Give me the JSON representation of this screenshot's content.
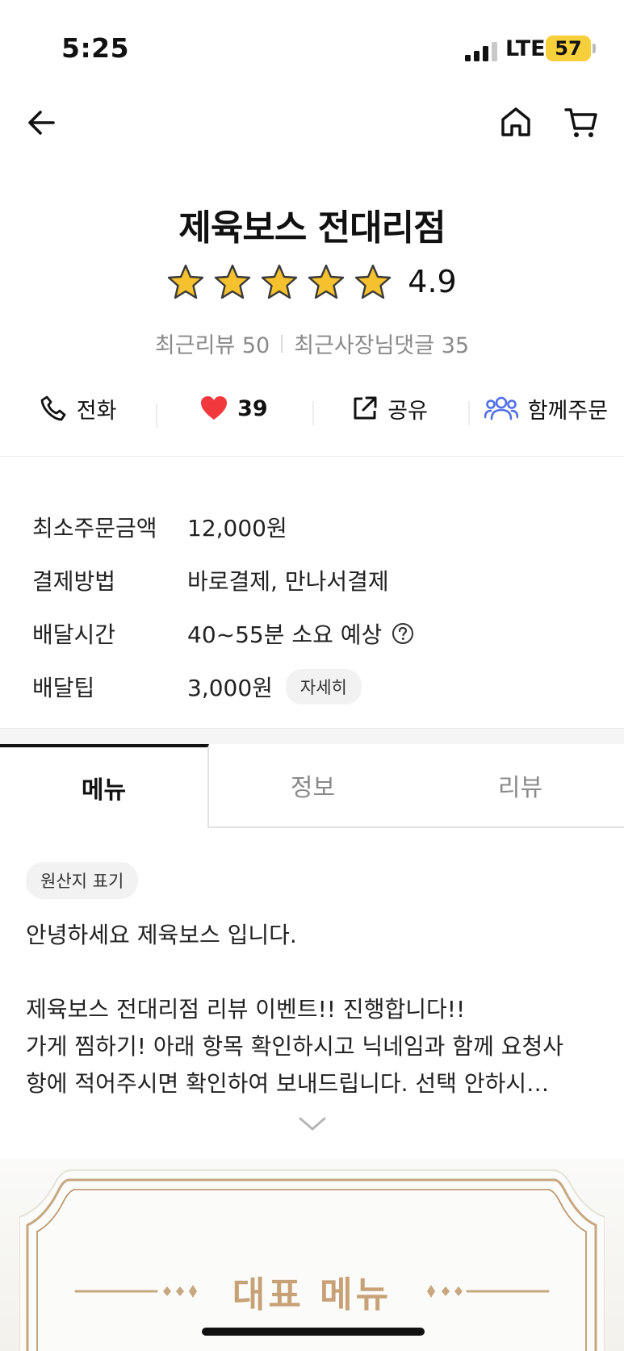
{
  "status_bar": {
    "time": "5:25",
    "network": "LTE",
    "battery": "57"
  },
  "nav": {
    "back_icon": "arrow-left-icon",
    "home_icon": "home-icon",
    "cart_icon": "cart-icon"
  },
  "store": {
    "name": "제육보스 전대리점",
    "rating": "4.9",
    "stars": 5,
    "recent_reviews": "최근리뷰 50",
    "owner_replies": "최근사장님댓글 35"
  },
  "actions": {
    "call": "전화",
    "likes": "39",
    "share": "공유",
    "group_order": "함께주문"
  },
  "info": {
    "min_order_label": "최소주문금액",
    "min_order_value": "12,000원",
    "payment_label": "결제방법",
    "payment_value": "바로결제, 만나서결제",
    "delivery_time_label": "배달시간",
    "delivery_time_value": "40~55분 소요 예상",
    "delivery_tip_label": "배달팁",
    "delivery_tip_value": "3,000원",
    "detail_button": "자세히"
  },
  "tabs": [
    {
      "label": "메뉴",
      "active": true
    },
    {
      "label": "정보",
      "active": false
    },
    {
      "label": "리뷰",
      "active": false
    }
  ],
  "notice": {
    "origin_chip": "원산지 표기",
    "line1": "안녕하세요 제육보스 입니다.",
    "line2": "제육보스 전대리점 리뷰 이벤트!! 진행합니다!!",
    "line3": "가게 찜하기! 아래 항목 확인하시고 닉네임과 함께 요청사",
    "line4": "항에 적어주시면 확인하여 보내드립니다. 선택 안하시…"
  },
  "banner": {
    "title": "대표 메뉴"
  },
  "colors": {
    "star": "#f5c12e",
    "heart": "#f0383d",
    "group_icon": "#4f6fe8",
    "banner_gold": "#c8a277"
  }
}
